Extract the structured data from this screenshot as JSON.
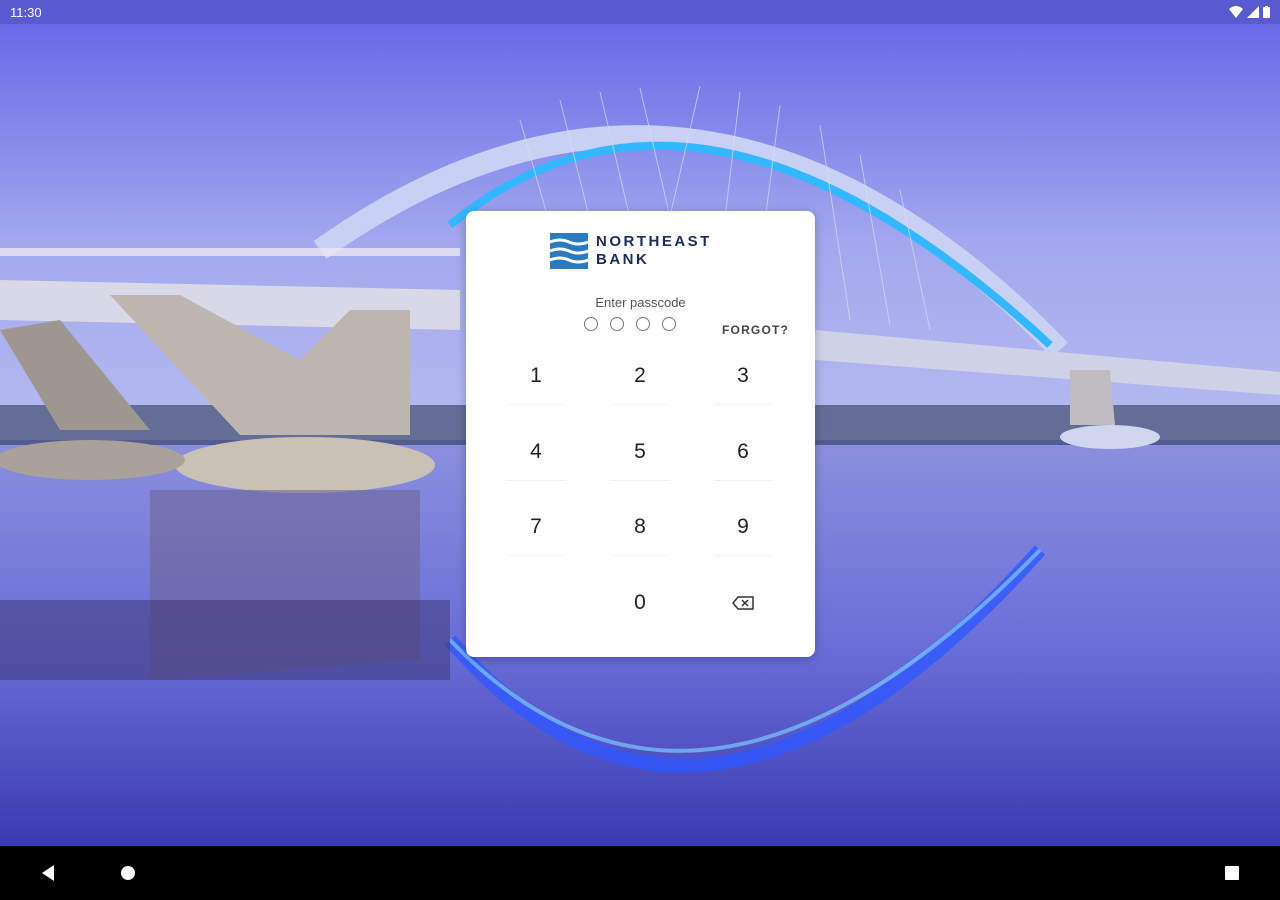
{
  "status_bar": {
    "time": "11:30"
  },
  "brand": {
    "line1": "NORTHEAST",
    "line2": "BANK"
  },
  "passcode": {
    "prompt": "Enter passcode",
    "digits_entered": 0,
    "digits_total": 4,
    "forgot_label": "FORGOT?"
  },
  "keypad": {
    "k1": "1",
    "k2": "2",
    "k3": "3",
    "k4": "4",
    "k5": "5",
    "k6": "6",
    "k7": "7",
    "k8": "8",
    "k9": "9",
    "k0": "0"
  },
  "colors": {
    "brand_navy": "#1d2d5b",
    "brand_blue": "#2a7ac0",
    "status_bar": "#5a5ad0"
  }
}
